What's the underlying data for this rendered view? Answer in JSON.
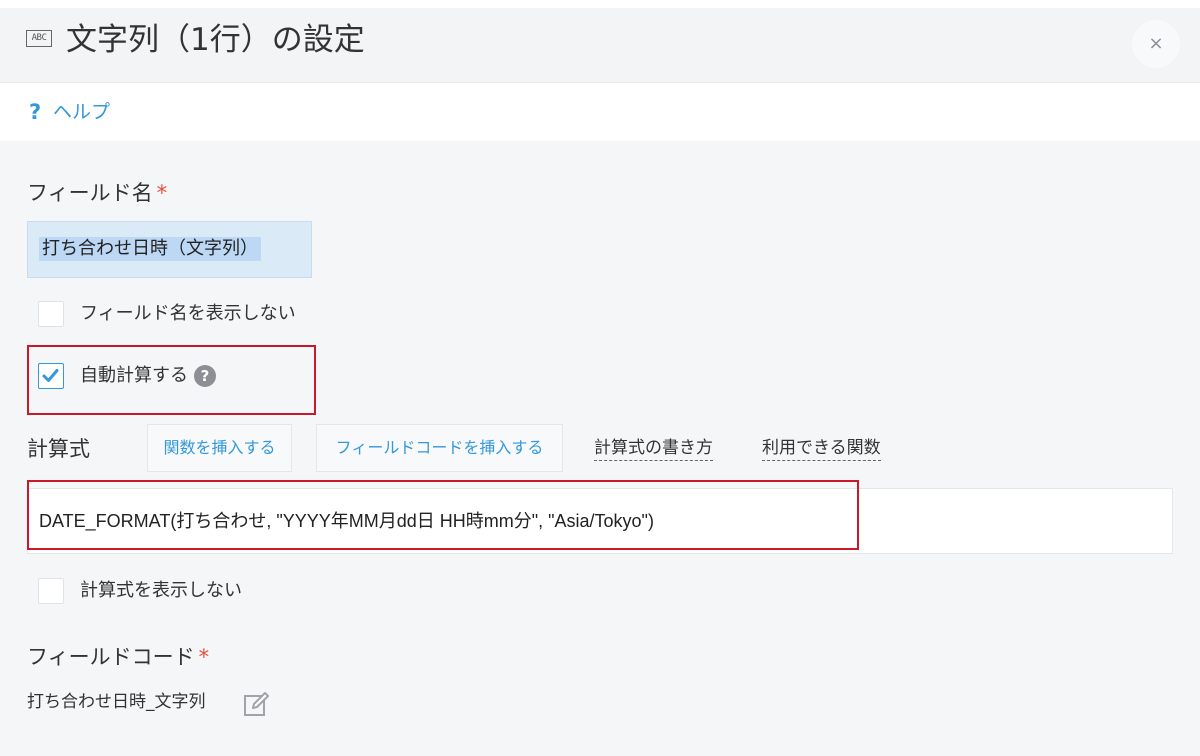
{
  "header": {
    "type_icon_text": "ABC",
    "title": "文字列（1行）の設定",
    "close_label": "×"
  },
  "help": {
    "icon": "?",
    "label": "ヘルプ"
  },
  "field_name": {
    "label": "フィールド名",
    "required_mark": "*",
    "value": "打ち合わせ日時（文字列）"
  },
  "options": {
    "hide_field_name": {
      "label": "フィールド名を表示しない",
      "checked": false
    },
    "auto_calc": {
      "label": "自動計算する",
      "checked": true,
      "help_icon": "?"
    }
  },
  "formula": {
    "label": "計算式",
    "insert_function_button": "関数を挿入する",
    "insert_field_code_button": "フィールドコードを挿入する",
    "how_to_write_link": "計算式の書き方",
    "available_functions_link": "利用できる関数",
    "value": "DATE_FORMAT(打ち合わせ, \"YYYY年MM月dd日 HH時mm分\", \"Asia/Tokyo\")",
    "hide_formula": {
      "label": "計算式を表示しない",
      "checked": false
    }
  },
  "field_code": {
    "label": "フィールドコード",
    "required_mark": "*",
    "value": "打ち合わせ日時_文字列"
  },
  "colors": {
    "link_blue": "#3498db",
    "highlight_red": "#c8182a",
    "required_red": "#e74c3c",
    "background": "#f4f6f8"
  }
}
